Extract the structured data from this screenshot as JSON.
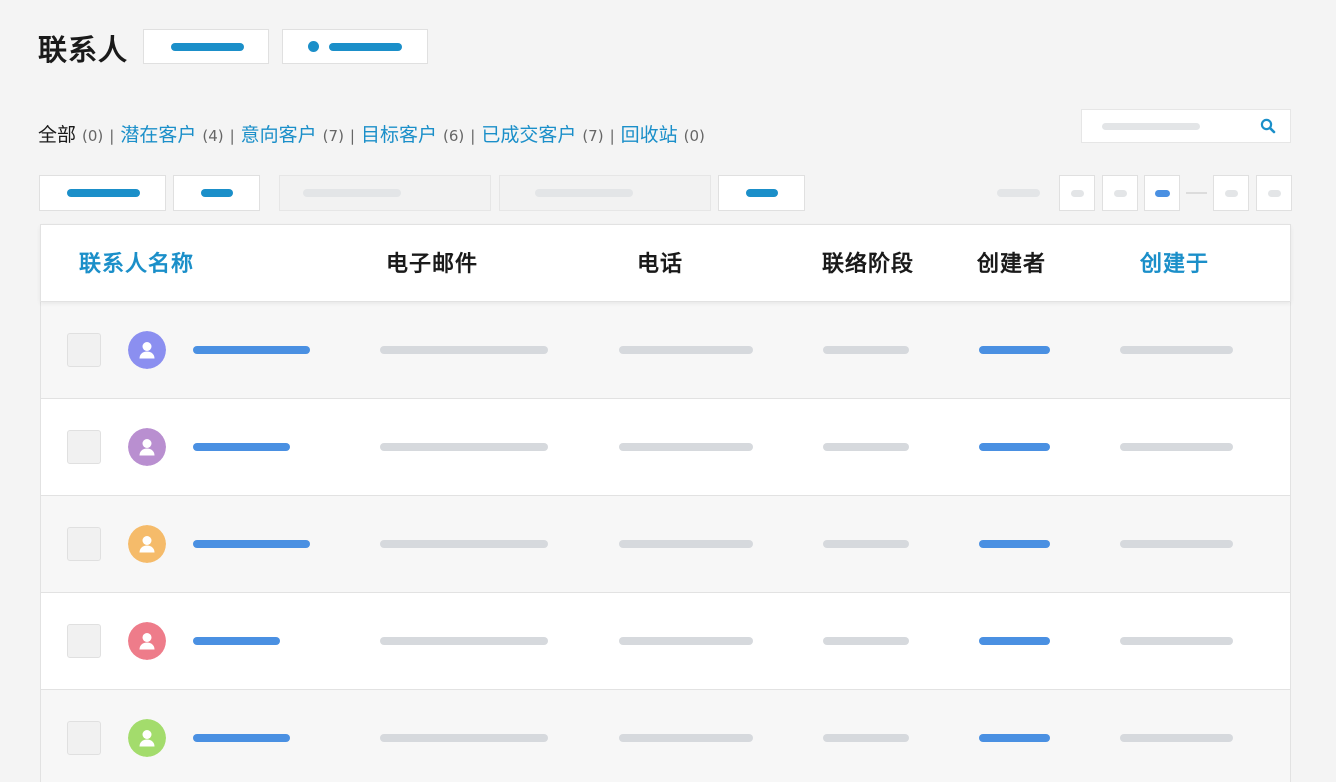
{
  "header": {
    "title": "联系人"
  },
  "filters": [
    {
      "label": "全部",
      "count": "(0)",
      "active": true
    },
    {
      "label": "潜在客户",
      "count": "(4)",
      "active": false
    },
    {
      "label": "意向客户",
      "count": "(7)",
      "active": false
    },
    {
      "label": "目标客户",
      "count": "(6)",
      "active": false
    },
    {
      "label": "已成交客户",
      "count": "(7)",
      "active": false
    },
    {
      "label": "回收站",
      "count": "(0)",
      "active": false
    }
  ],
  "filter_separator": "|",
  "table": {
    "columns": [
      "联系人名称",
      "电子邮件",
      "电话",
      "联络阶段",
      "创建者",
      "创建于"
    ]
  },
  "avatars": [
    "#8b8ff0",
    "#b98fd0",
    "#f5bb6a",
    "#ee7c8a",
    "#a3dc6c"
  ],
  "colors": {
    "accent": "#1b8fc9",
    "link_blue": "#4a90e2",
    "placeholder_gray": "#d6d9dd"
  },
  "icons": {
    "search": "search-icon",
    "avatar": "user-icon"
  }
}
